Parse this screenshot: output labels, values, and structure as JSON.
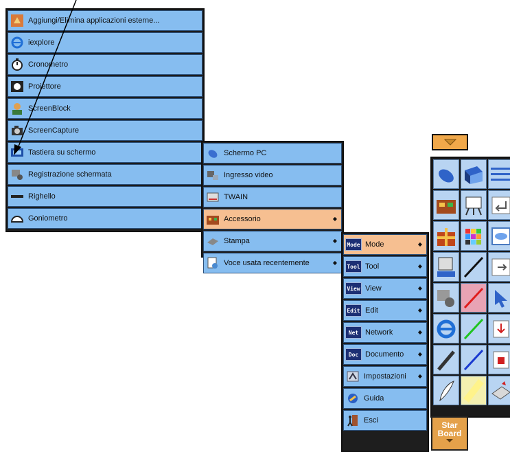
{
  "menu_apps": {
    "items": [
      {
        "label": "Aggiungi/Elimina applicazioni esterne...",
        "icon": "add-remove-apps-icon"
      },
      {
        "label": "iexplore",
        "icon": "internet-explorer-icon"
      },
      {
        "label": "Cronometro",
        "icon": "stopwatch-icon"
      },
      {
        "label": "Proiettore",
        "icon": "projector-icon"
      },
      {
        "label": "ScreenBlock",
        "icon": "screen-block-icon"
      },
      {
        "label": "ScreenCapture",
        "icon": "camera-icon"
      },
      {
        "label": "Tastiera su schermo",
        "icon": "on-screen-keyboard-icon"
      },
      {
        "label": "Registrazione schermata",
        "icon": "screen-recording-icon"
      },
      {
        "label": "Righello",
        "icon": "ruler-icon"
      },
      {
        "label": "Goniometro",
        "icon": "protractor-icon"
      }
    ]
  },
  "menu_accessory": {
    "items": [
      {
        "label": "Schermo PC",
        "icon": "mouse-icon",
        "has_submenu": false
      },
      {
        "label": "Ingresso video",
        "icon": "video-input-icon",
        "has_submenu": false
      },
      {
        "label": "TWAIN",
        "icon": "scanner-icon",
        "has_submenu": false
      },
      {
        "label": "Accessorio",
        "icon": "toolbox-icon",
        "has_submenu": true,
        "highlighted": true
      },
      {
        "label": "Stampa",
        "icon": "printer-icon",
        "has_submenu": true
      },
      {
        "label": "Voce usata recentemente",
        "icon": "recent-items-icon",
        "has_submenu": true
      }
    ],
    "arrow_glyph": "◆"
  },
  "menu_main": {
    "items": [
      {
        "badge": "Mode",
        "label": "Mode",
        "has_submenu": true,
        "highlighted": true
      },
      {
        "badge": "Tool",
        "label": "Tool",
        "has_submenu": true
      },
      {
        "badge": "View",
        "label": "View",
        "has_submenu": true
      },
      {
        "badge": "Edit",
        "label": "Edit",
        "has_submenu": true
      },
      {
        "badge": "Net",
        "label": "Network",
        "has_submenu": true
      },
      {
        "badge": "Doc",
        "label": "Documento",
        "has_submenu": true
      },
      {
        "badge": "",
        "label": "Impostazioni",
        "icon": "settings-icon",
        "has_submenu": true
      },
      {
        "badge": "",
        "label": "Guida",
        "icon": "help-icon",
        "has_submenu": false
      },
      {
        "badge": "",
        "label": "Esci",
        "icon": "exit-icon",
        "has_submenu": false
      }
    ],
    "arrow_glyph": "◆"
  },
  "toolbar": {
    "star_line1": "Star",
    "star_line2": "Board"
  },
  "colors": {
    "item_bg": "#86bdf0",
    "item_highlight": "#f6bf91",
    "menu_border": "#1e1e1e",
    "toolbar_button": "#b8d4f2",
    "star_button": "#e4a14a"
  }
}
